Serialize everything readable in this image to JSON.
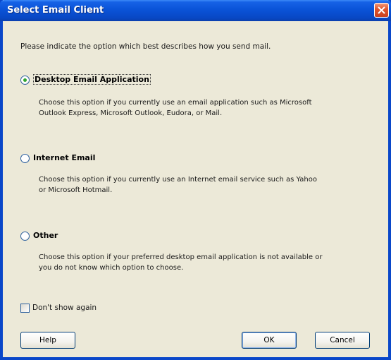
{
  "window": {
    "title": "Select Email Client"
  },
  "instruction": "Please indicate the option which best describes how you send mail.",
  "options": [
    {
      "label": "Desktop Email Application",
      "selected": true,
      "description_line1": "Choose this option if you currently use an email application such as Microsoft",
      "description_line2": "Outlook Express, Microsoft Outlook, Eudora, or Mail."
    },
    {
      "label": "Internet Email",
      "selected": false,
      "description_line1": "Choose this option if you currently use an Internet email service such as Yahoo",
      "description_line2": "or Microsoft Hotmail."
    },
    {
      "label": "Other",
      "selected": false,
      "description_line1": "Choose this option if your preferred desktop email application is not available or",
      "description_line2": "you do not know which option to choose."
    }
  ],
  "dont_show_again": {
    "label": "Don't show again",
    "checked": false
  },
  "buttons": {
    "help": "Help",
    "ok": "OK",
    "cancel": "Cancel"
  },
  "colors": {
    "titlebar": "#0a53d8",
    "dialog_background": "#ece9d8",
    "close_button": "#e0552c",
    "radio_selected_dot": "#2fa52f"
  }
}
